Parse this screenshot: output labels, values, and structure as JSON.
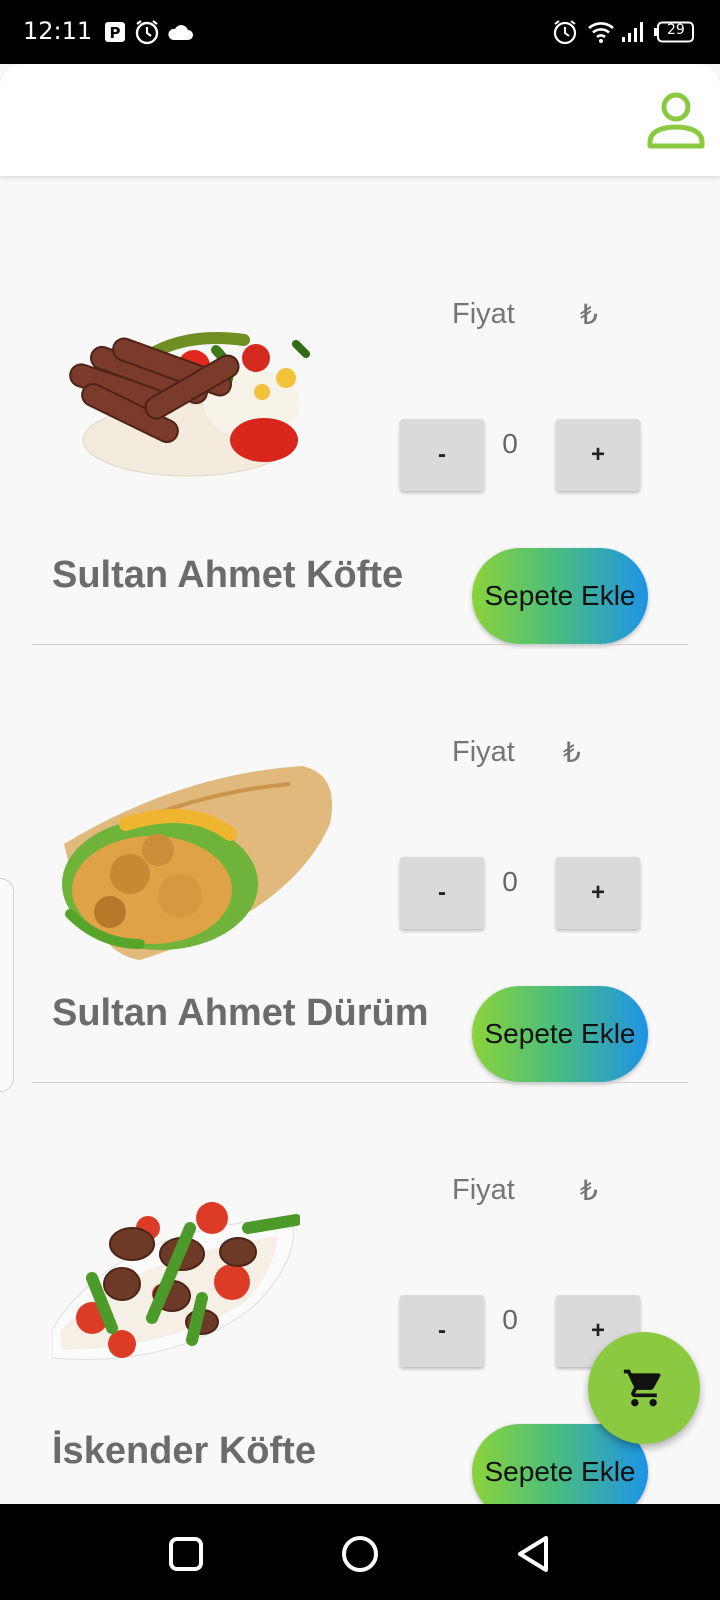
{
  "status_bar": {
    "time": "12:11",
    "battery": "29",
    "icons": [
      "parking-icon",
      "alarm-icon",
      "cloud-icon",
      "alarm-icon",
      "wifi-icon",
      "signal-icon",
      "battery-icon"
    ]
  },
  "app_bar": {
    "profile_icon": "person-icon",
    "accent": "#8bc940"
  },
  "products": [
    {
      "name": "Sultan Ahmet Köfte",
      "price_label": "Fiyat",
      "currency": "₺",
      "quantity": "0",
      "minus": "-",
      "plus": "+",
      "add_label": "Sepete Ekle",
      "image": "kofte-plate-image"
    },
    {
      "name": "Sultan Ahmet Dürüm",
      "price_label": "Fiyat",
      "currency": "₺",
      "quantity": "0",
      "minus": "-",
      "plus": "+",
      "add_label": "Sepete Ekle",
      "image": "durum-wrap-image"
    },
    {
      "name": "İskender Köfte",
      "price_label": "Fiyat",
      "currency": "₺",
      "quantity": "0",
      "minus": "-",
      "plus": "+",
      "add_label": "Sepete Ekle",
      "image": "iskender-plate-image"
    }
  ],
  "fab": {
    "icon": "cart-icon"
  },
  "nav": {
    "icons": [
      "recent-apps-icon",
      "home-icon",
      "back-icon"
    ]
  }
}
